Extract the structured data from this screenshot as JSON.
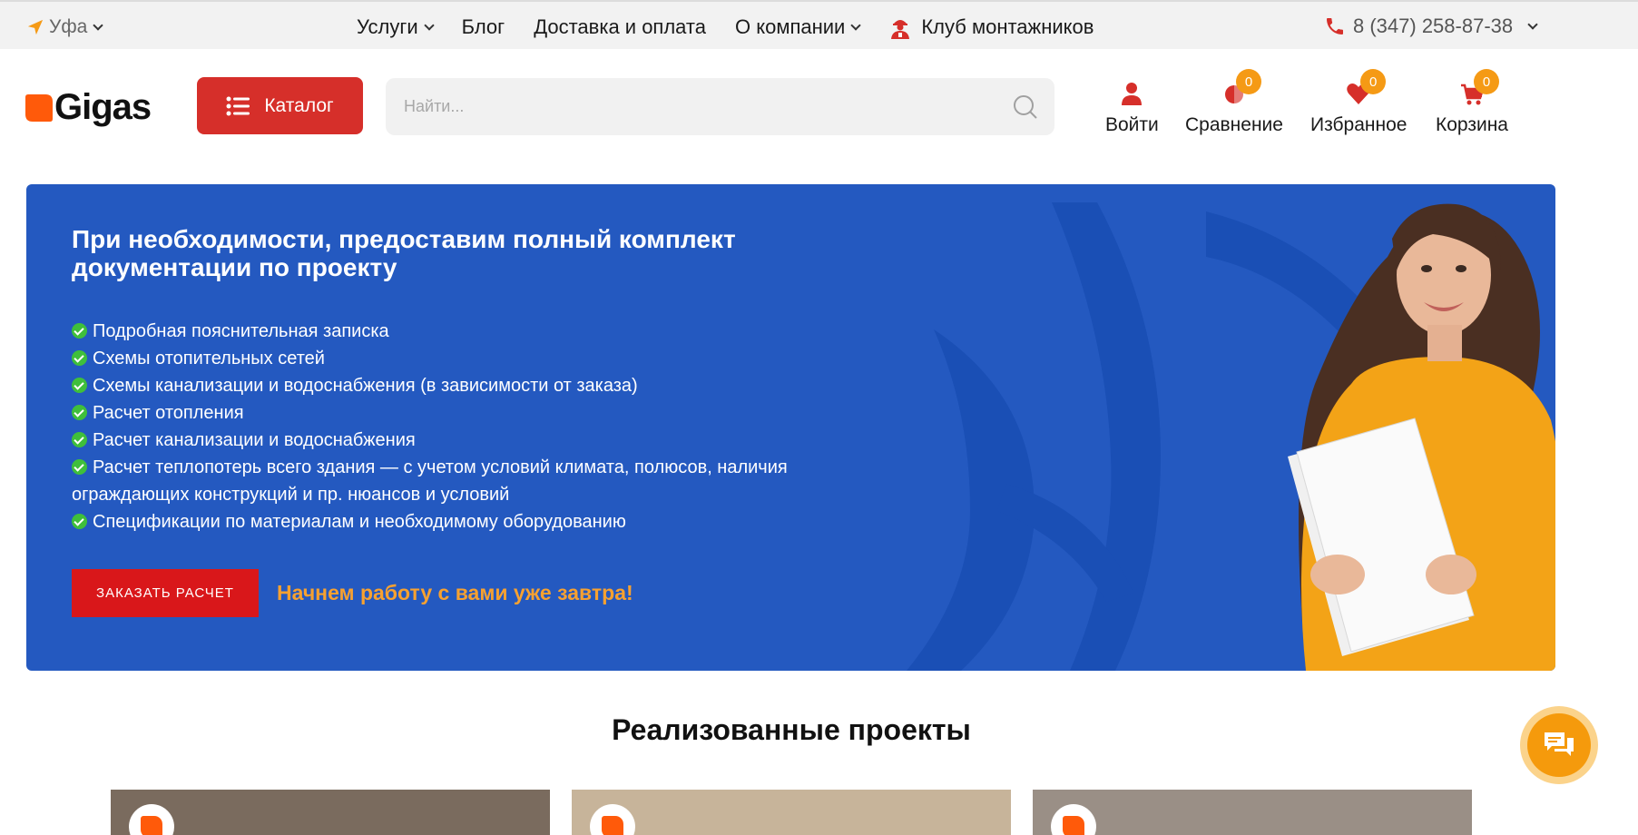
{
  "topbar": {
    "city": "Уфа",
    "nav": [
      {
        "label": "Услуги",
        "has_dropdown": true
      },
      {
        "label": "Блог",
        "has_dropdown": false
      },
      {
        "label": "Доставка и оплата",
        "has_dropdown": false
      },
      {
        "label": "О компании",
        "has_dropdown": true
      }
    ],
    "club_label": "Клуб монтажников",
    "phone": "8 (347) 258-87-38"
  },
  "header": {
    "logo_text": "Gigas",
    "catalog_label": "Каталог",
    "search_placeholder": "Найти...",
    "actions": [
      {
        "label": "Войти",
        "icon": "user-icon"
      },
      {
        "label": "Сравнение",
        "icon": "compare-icon",
        "count": "0"
      },
      {
        "label": "Избранное",
        "icon": "heart-icon",
        "count": "0"
      },
      {
        "label": "Корзина",
        "icon": "cart-icon",
        "count": "0"
      }
    ]
  },
  "banner": {
    "title": "При необходимости, предоставим полный комплект документации по проекту",
    "features": [
      "Подробная пояснительная записка",
      "Схемы отопительных сетей",
      "Схемы канализации и водоснабжения (в зависимости от заказа)",
      "Расчет отопления",
      "Расчет канализации и водоснабжения",
      "Расчет теплопотерь всего здания — с учетом условий климата, полюсов, наличия ограждающих конструкций и пр. нюансов и условий",
      "Спецификации по материалам и необходимому оборудованию"
    ],
    "cta_label": "ЗАКАЗАТЬ РАСЧЕТ",
    "promo_text": "Начнем работу с вами уже завтра!"
  },
  "projects": {
    "title": "Реализованные проекты"
  },
  "colors": {
    "brand_red": "#d62f2a",
    "banner_blue": "#2459c0",
    "accent_orange": "#f59a15",
    "check_green": "#3fbf3b"
  }
}
